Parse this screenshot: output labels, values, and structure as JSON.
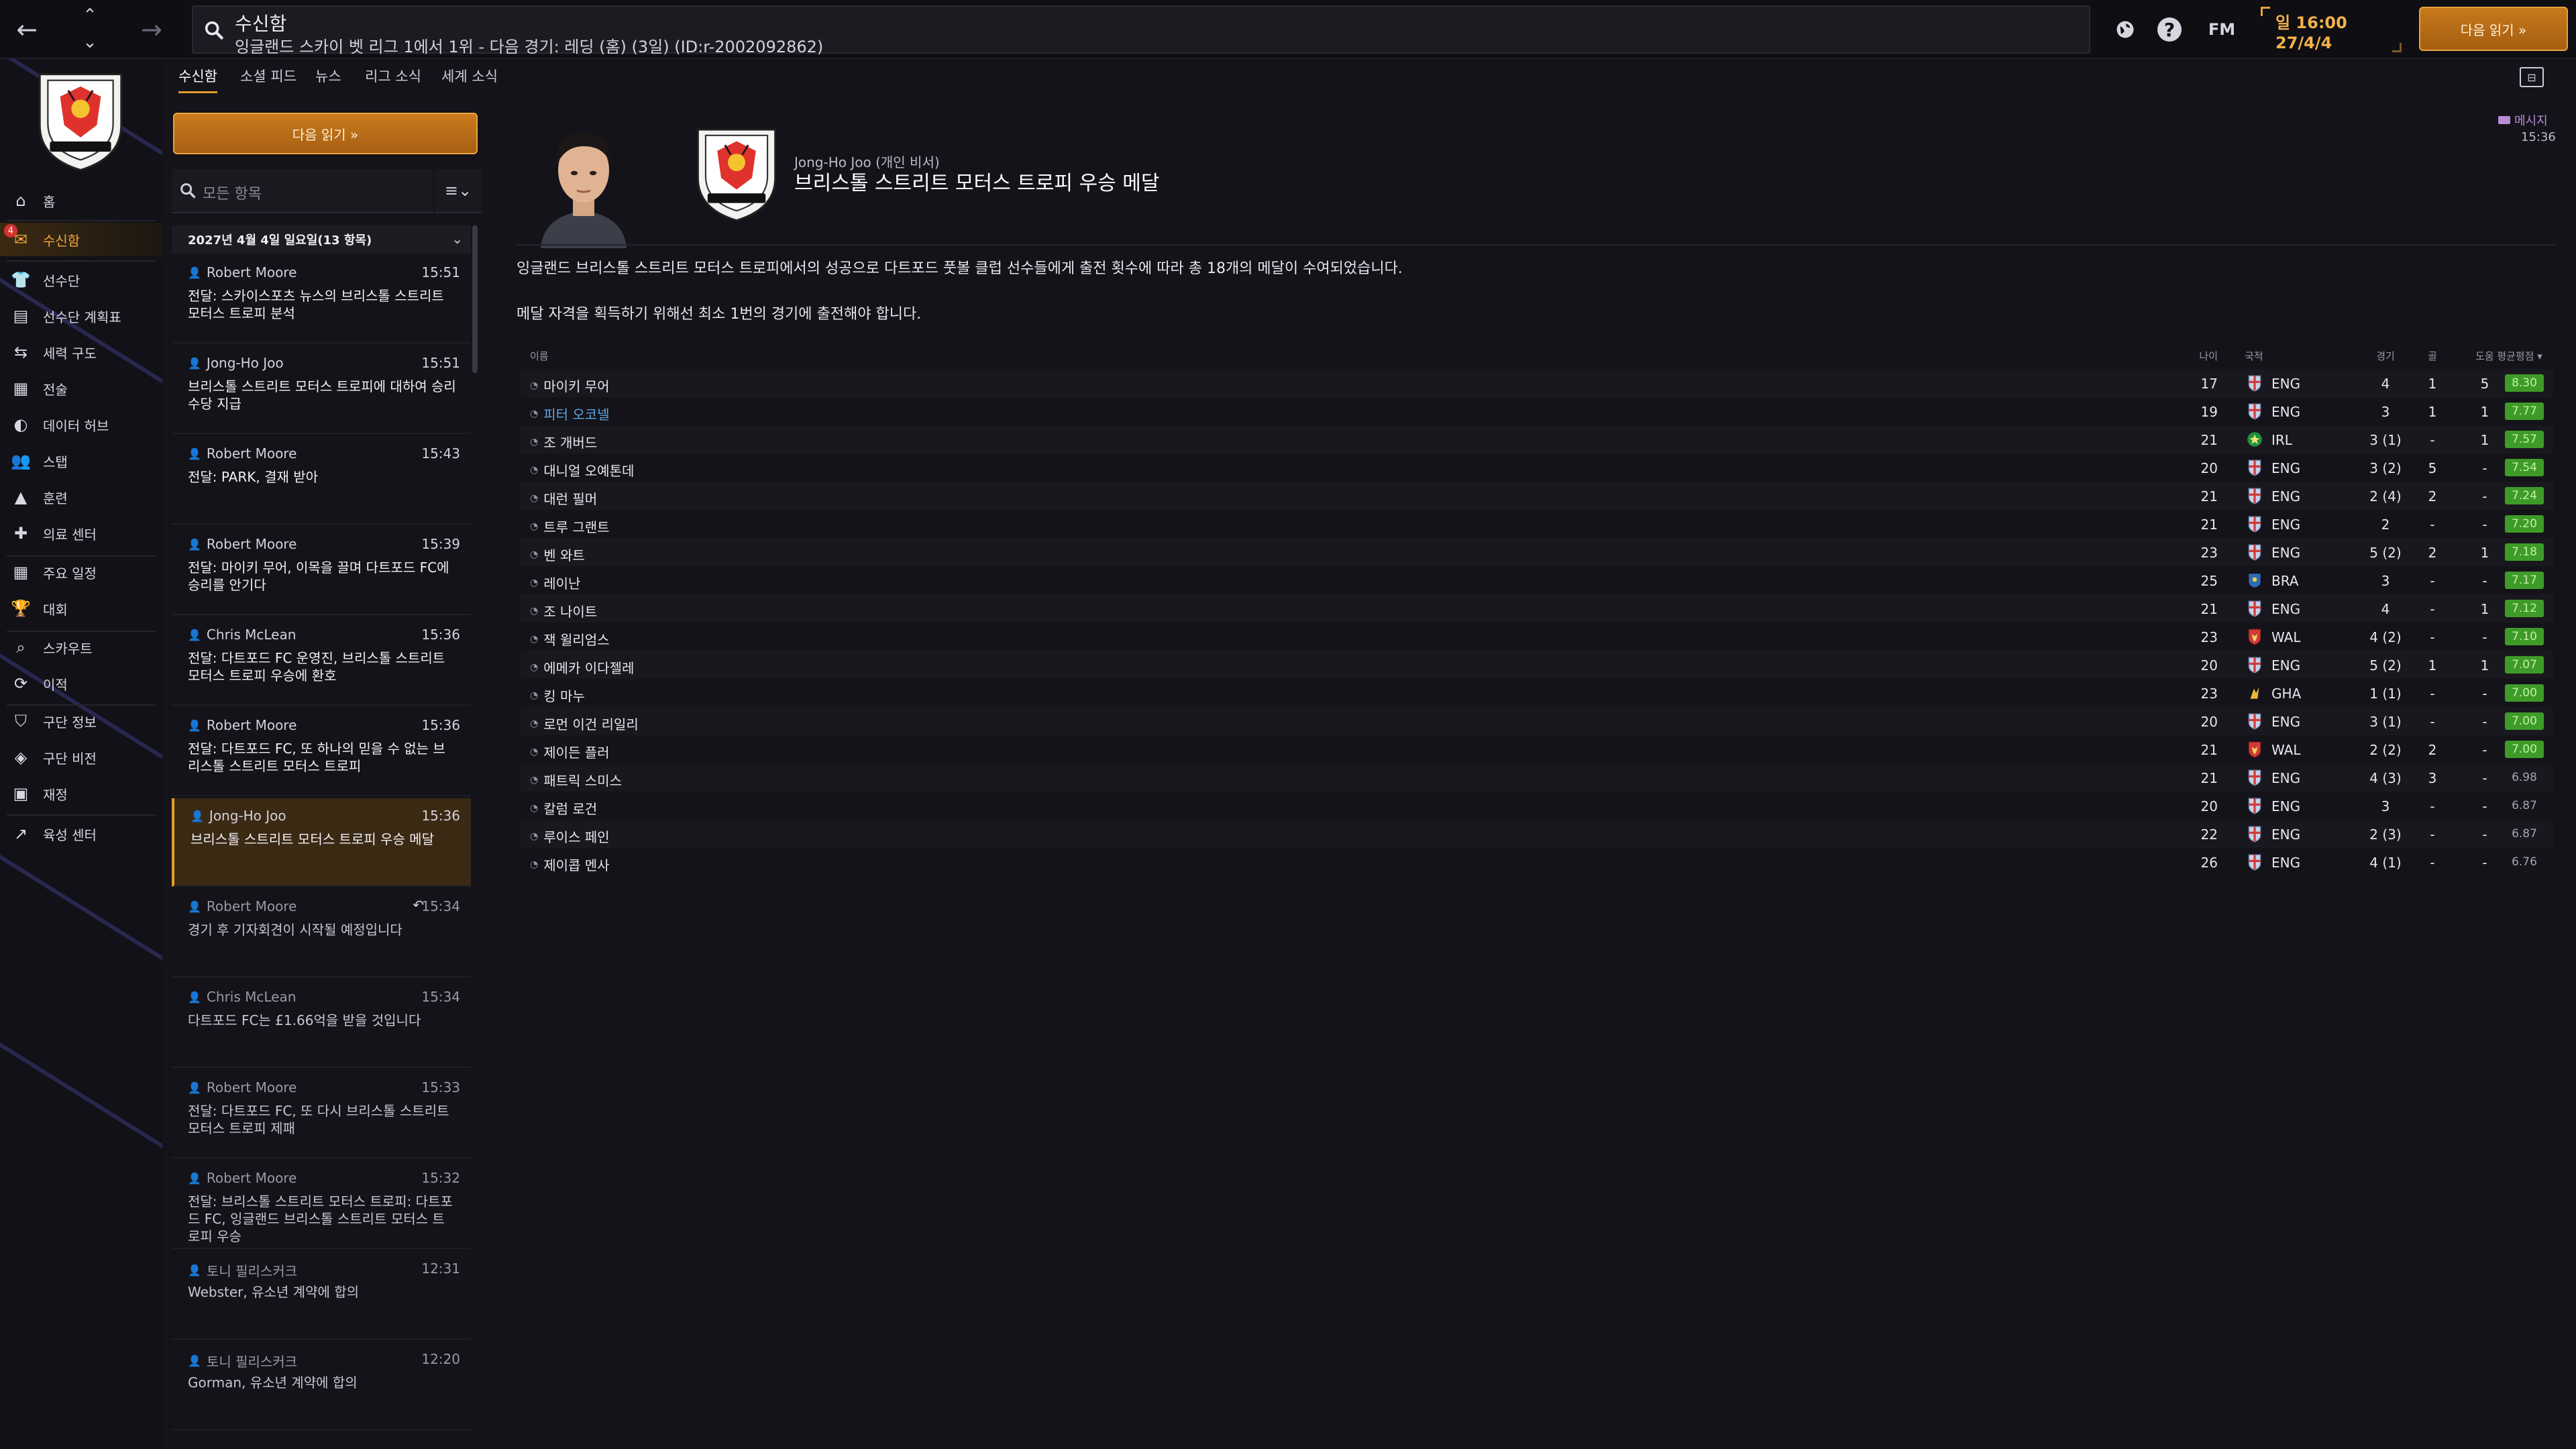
{
  "topbar": {
    "search_title": "수신함",
    "search_sub": "잉글랜드 스카이 벳 리그 1에서 1위 - 다음 경기: 레딩 (홈) (3일) (ID:r-2002092862)",
    "icons": [
      "back-arrow-icon",
      "up-chevron-icon",
      "down-chevron-icon",
      "forward-arrow-icon",
      "search-icon",
      "world-icon",
      "help-icon",
      "fm-logo-icon"
    ],
    "fm_label": "FM",
    "help_label": "?",
    "time": "일 16:00",
    "date": "27/4/4",
    "continue_label": "다음 읽기 »",
    "accent": "#e69c2e"
  },
  "sidebar": {
    "items": [
      {
        "label": "홈",
        "icon": "home-icon"
      },
      {
        "label": "수신함",
        "icon": "inbox-icon",
        "badge": "4"
      },
      {
        "label": "선수단",
        "icon": "shirt-icon"
      },
      {
        "label": "선수단 계획표",
        "icon": "clipboard-icon"
      },
      {
        "label": "세력 구도",
        "icon": "arrows-icon"
      },
      {
        "label": "전술",
        "icon": "tactics-board-icon"
      },
      {
        "label": "데이터 허브",
        "icon": "data-hub-icon"
      },
      {
        "label": "스탭",
        "icon": "staff-icon"
      },
      {
        "label": "훈련",
        "icon": "training-cone-icon"
      },
      {
        "label": "의료 센터",
        "icon": "medical-kit-icon"
      },
      {
        "label": "주요 일정",
        "icon": "calendar-icon"
      },
      {
        "label": "대회",
        "icon": "trophy-icon"
      },
      {
        "label": "스카우트",
        "icon": "scout-search-icon"
      },
      {
        "label": "이적",
        "icon": "transfer-icon"
      },
      {
        "label": "구단 정보",
        "icon": "shield-icon"
      },
      {
        "label": "구단 비전",
        "icon": "vision-icon"
      },
      {
        "label": "재정",
        "icon": "finance-icon"
      },
      {
        "label": "육성 센터",
        "icon": "development-icon"
      }
    ]
  },
  "tabs": [
    "수신함",
    "소셜 피드",
    "뉴스",
    "리그 소식",
    "세계 소식"
  ],
  "message_list": {
    "continue_label": "다음 읽기 »",
    "search_placeholder": "모든 항목",
    "filter_label": "≡⌄",
    "date_header": "2027년 4월 4일 일요일(13 항목)",
    "messages": [
      {
        "sender": "Robert Moore",
        "time": "15:51",
        "subject": "전달: 스카이스포츠 뉴스의 브리스톨 스트리트 모터스 트로피 분석"
      },
      {
        "sender": "Jong-Ho Joo",
        "time": "15:51",
        "subject": "브리스톨 스트리트 모터스 트로피에 대하여 승리 수당 지급"
      },
      {
        "sender": "Robert Moore",
        "time": "15:43",
        "subject": "전달: PARK, 결재 받아"
      },
      {
        "sender": "Robert Moore",
        "time": "15:39",
        "subject": "전달: 마이키 무어, 이목을 끌며 다트포드 FC에 승리를 안기다"
      },
      {
        "sender": "Chris McLean",
        "time": "15:36",
        "subject": "전달: 다트포드 FC 운영진, 브리스톨 스트리트 모터스 트로피 우승에 환호"
      },
      {
        "sender": "Robert Moore",
        "time": "15:36",
        "subject": "전달: 다트포드 FC, 또 하나의 믿을 수 없는 브리스톨 스트리트 모터스 트로피"
      },
      {
        "sender": "Jong-Ho Joo",
        "time": "15:36",
        "subject": "브리스톨 스트리트 모터스 트로피 우승 메달",
        "selected": true
      },
      {
        "sender": "Robert Moore",
        "time": "15:34",
        "subject": "경기 후 기자회견이 시작될 예정입니다",
        "read": true,
        "replied": true
      },
      {
        "sender": "Chris McLean",
        "time": "15:34",
        "subject": "다트포드 FC는 £1.66억을 받을 것입니다",
        "read": true
      },
      {
        "sender": "Robert Moore",
        "time": "15:33",
        "subject": "전달: 다트포드 FC, 또 다시 브리스톨 스트리트 모터스 트로피 제패",
        "read": true
      },
      {
        "sender": "Robert Moore",
        "time": "15:32",
        "subject": "전달: 브리스톨 스트리트 모터스 트로피: 다트포드 FC, 잉글랜드 브리스톨 스트리트 모터스 트로피 우승",
        "read": true
      },
      {
        "sender": "토니 필리스커크",
        "time": "12:31",
        "subject": "Webster, 유소년 계약에 합의",
        "read": true
      },
      {
        "sender": "토니 필리스커크",
        "time": "12:20",
        "subject": "Gorman, 유소년 계약에 합의",
        "read": true
      }
    ]
  },
  "message": {
    "tag": "메시지",
    "tag_time": "15:36",
    "from": "Jong-Ho Joo (개인 비서)",
    "title": "브리스톨 스트리트 모터스 트로피 우승 메달",
    "body_1": "잉글랜드 브리스톨 스트리트 모터스 트로피에서의 성공으로 다트포드 풋볼 클럽 선수들에게 출전 횟수에 따라 총 18개의 메달이 수여되었습니다.",
    "body_2": "메달 자격을 획득하기 위해선 최소 1번의 경기에 출전해야 합니다."
  },
  "table": {
    "headers": {
      "name": "이름",
      "age": "나이",
      "nat": "국적",
      "apps": "경기",
      "goals": "골",
      "assists": "도움",
      "rating": "평균평점 ▾"
    },
    "rows": [
      {
        "name": "마이키 무어",
        "age": "17",
        "nat": "ENG",
        "flag": "england",
        "apps": "4",
        "goals": "1",
        "assists": "5",
        "rating": "8.30",
        "badge": true
      },
      {
        "name": "피터 오코넬",
        "age": "19",
        "nat": "ENG",
        "flag": "england",
        "apps": "3",
        "goals": "1",
        "assists": "1",
        "rating": "7.77",
        "badge": true,
        "link": true
      },
      {
        "name": "조 개버드",
        "age": "21",
        "nat": "IRL",
        "flag": "ireland",
        "apps": "3 (1)",
        "goals": "-",
        "assists": "1",
        "rating": "7.57",
        "badge": true
      },
      {
        "name": "대니얼 오예톤데",
        "age": "20",
        "nat": "ENG",
        "flag": "england",
        "apps": "3 (2)",
        "goals": "5",
        "assists": "-",
        "rating": "7.54",
        "badge": true
      },
      {
        "name": "대런 필머",
        "age": "21",
        "nat": "ENG",
        "flag": "england",
        "apps": "2 (4)",
        "goals": "2",
        "assists": "-",
        "rating": "7.24",
        "badge": true
      },
      {
        "name": "트루 그랜트",
        "age": "21",
        "nat": "ENG",
        "flag": "england",
        "apps": "2",
        "goals": "-",
        "assists": "-",
        "rating": "7.20",
        "badge": true
      },
      {
        "name": "벤 와트",
        "age": "23",
        "nat": "ENG",
        "flag": "england",
        "apps": "5 (2)",
        "goals": "2",
        "assists": "1",
        "rating": "7.18",
        "badge": true
      },
      {
        "name": "레이난",
        "age": "25",
        "nat": "BRA",
        "flag": "brazil",
        "apps": "3",
        "goals": "-",
        "assists": "-",
        "rating": "7.17",
        "badge": true
      },
      {
        "name": "조 나이트",
        "age": "21",
        "nat": "ENG",
        "flag": "england",
        "apps": "4",
        "goals": "-",
        "assists": "1",
        "rating": "7.12",
        "badge": true
      },
      {
        "name": "잭 윌리엄스",
        "age": "23",
        "nat": "WAL",
        "flag": "wales",
        "apps": "4 (2)",
        "goals": "-",
        "assists": "-",
        "rating": "7.10",
        "badge": true
      },
      {
        "name": "에메카 이다젤레",
        "age": "20",
        "nat": "ENG",
        "flag": "england",
        "apps": "5 (2)",
        "goals": "1",
        "assists": "1",
        "rating": "7.07",
        "badge": true
      },
      {
        "name": "킹 마누",
        "age": "23",
        "nat": "GHA",
        "flag": "ghana",
        "apps": "1 (1)",
        "goals": "-",
        "assists": "-",
        "rating": "7.00",
        "badge": true
      },
      {
        "name": "로먼 이건 리일리",
        "age": "20",
        "nat": "ENG",
        "flag": "england",
        "apps": "3 (1)",
        "goals": "-",
        "assists": "-",
        "rating": "7.00",
        "badge": true
      },
      {
        "name": "제이든 플러",
        "age": "21",
        "nat": "WAL",
        "flag": "wales",
        "apps": "2 (2)",
        "goals": "2",
        "assists": "-",
        "rating": "7.00",
        "badge": true
      },
      {
        "name": "패트릭 스미스",
        "age": "21",
        "nat": "ENG",
        "flag": "england",
        "apps": "4 (3)",
        "goals": "3",
        "assists": "-",
        "rating": "6.98",
        "badge": false
      },
      {
        "name": "칼럼 로건",
        "age": "20",
        "nat": "ENG",
        "flag": "england",
        "apps": "3",
        "goals": "-",
        "assists": "-",
        "rating": "6.87",
        "badge": false
      },
      {
        "name": "루이스 페인",
        "age": "22",
        "nat": "ENG",
        "flag": "england",
        "apps": "2 (3)",
        "goals": "-",
        "assists": "-",
        "rating": "6.87",
        "badge": false
      },
      {
        "name": "제이콥 멘사",
        "age": "26",
        "nat": "ENG",
        "flag": "england",
        "apps": "4 (1)",
        "goals": "-",
        "assists": "-",
        "rating": "6.76",
        "badge": false
      }
    ]
  }
}
